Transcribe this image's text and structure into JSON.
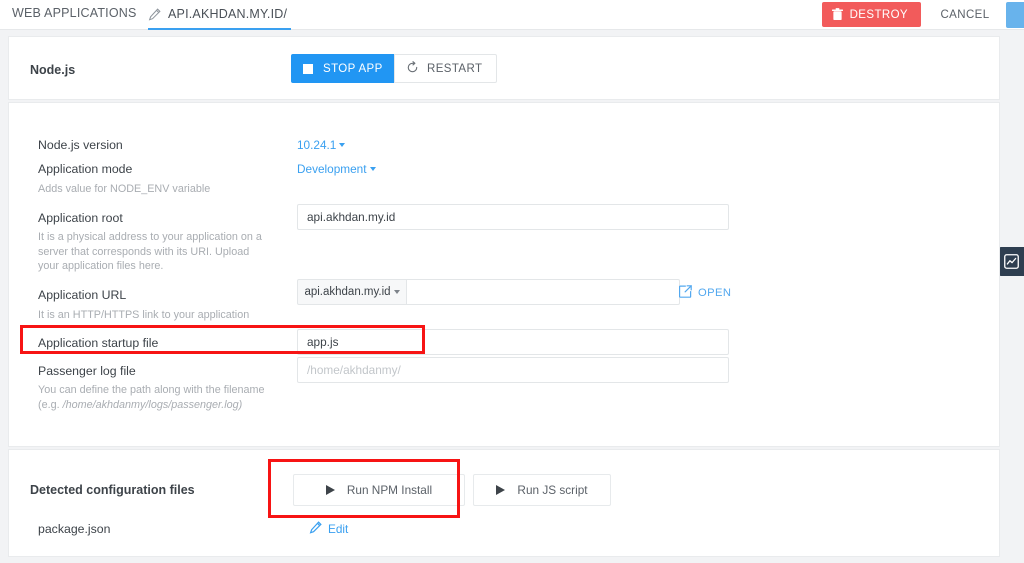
{
  "topbar": {
    "breadcrumb": "WEB APPLICATIONS",
    "active_tab": "API.AKHDAN.MY.ID/",
    "edit_icon": "pencil-icon",
    "destroy_label": "DESTROY",
    "destroy_icon": "trash-icon",
    "destroy_color": "#f25b5b",
    "cancel_label": "CANCEL",
    "accent_color": "#3aa0f0"
  },
  "rail": {
    "chart_icon": "chart-line-icon"
  },
  "app_header": {
    "title": "Node.js",
    "stop_label": "STOP APP",
    "stop_icon": "stop-square-icon",
    "restart_label": "RESTART",
    "restart_icon": "restart-arrow-icon"
  },
  "fields": {
    "node_version": {
      "label": "Node.js version",
      "value": "10.24.1"
    },
    "app_mode": {
      "label": "Application mode",
      "value": "Development",
      "hint": "Adds value for NODE_ENV variable"
    },
    "app_root": {
      "label": "Application root",
      "value": "api.akhdan.my.id",
      "hint": "It is a physical address to your application on a server that corresponds with its URI. Upload your application files here."
    },
    "app_url": {
      "label": "Application URL",
      "hint": "It is an HTTP/HTTPS link to your application",
      "prefix": "api.akhdan.my.id",
      "value": "",
      "open_label": "OPEN",
      "open_icon": "external-link-icon"
    },
    "startup_file": {
      "label": "Application startup file",
      "value": "app.js",
      "highlighted": true
    },
    "passenger_log": {
      "label": "Passenger log file",
      "placeholder": "/home/akhdanmy/",
      "value": "",
      "hint_line1": "You can define the path along with the filename (e.g.",
      "hint_line2": "/home/akhdanmy/logs/passenger.log)"
    }
  },
  "config_section": {
    "title": "Detected configuration files",
    "run_npm_label": "Run NPM Install",
    "run_js_label": "Run JS script",
    "play_icon": "play-triangle-icon",
    "file_name": "package.json",
    "edit_label": "Edit",
    "edit_icon": "pencil-icon"
  },
  "annotations": {
    "highlight_color": "#f71414",
    "boxes": [
      {
        "name": "startup-file-highlight"
      },
      {
        "name": "run-npm-install-highlight"
      }
    ]
  }
}
